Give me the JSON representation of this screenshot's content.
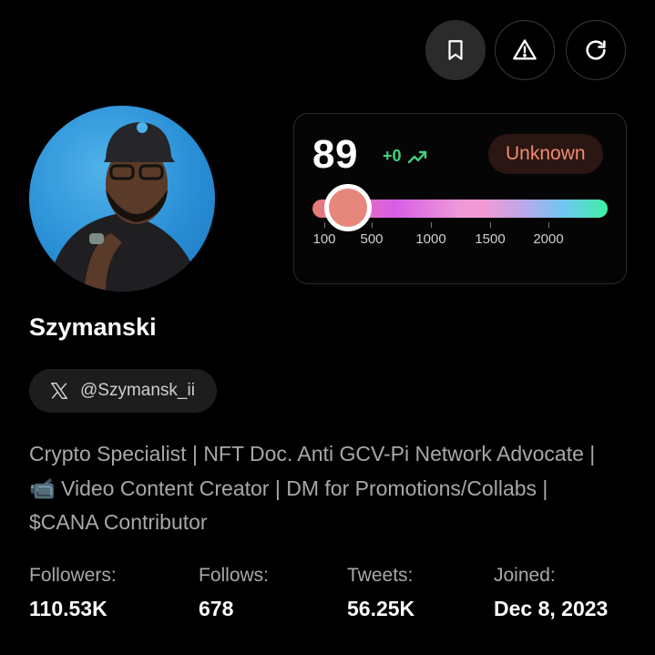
{
  "toolbar": {
    "bookmark_icon": "bookmark-icon",
    "report_icon": "warning-triangle-icon",
    "refresh_icon": "refresh-icon"
  },
  "profile": {
    "name": "Szymanski",
    "handle": "@Szymansk_ii",
    "platform_icon": "x-logo-icon",
    "bio": "Crypto Specialist | NFT Doc. Anti GCV-Pi Network Advocate | 📹 Video Content Creator | DM for Promotions/Collabs | $CANA Contributor"
  },
  "score": {
    "value": "89",
    "delta": "+0",
    "trend_icon": "trend-up-icon",
    "badge": "Unknown",
    "scale_ticks": [
      "100",
      "500",
      "1000",
      "1500",
      "2000"
    ],
    "colors": {
      "delta": "#3ed37e",
      "badge_text": "#f08a72",
      "knob": "#e5877a"
    }
  },
  "stats": [
    {
      "label": "Followers:",
      "value": "110.53K"
    },
    {
      "label": "Follows:",
      "value": "678"
    },
    {
      "label": "Tweets:",
      "value": "56.25K"
    },
    {
      "label": "Joined:",
      "value": "Dec 8, 2023"
    }
  ]
}
